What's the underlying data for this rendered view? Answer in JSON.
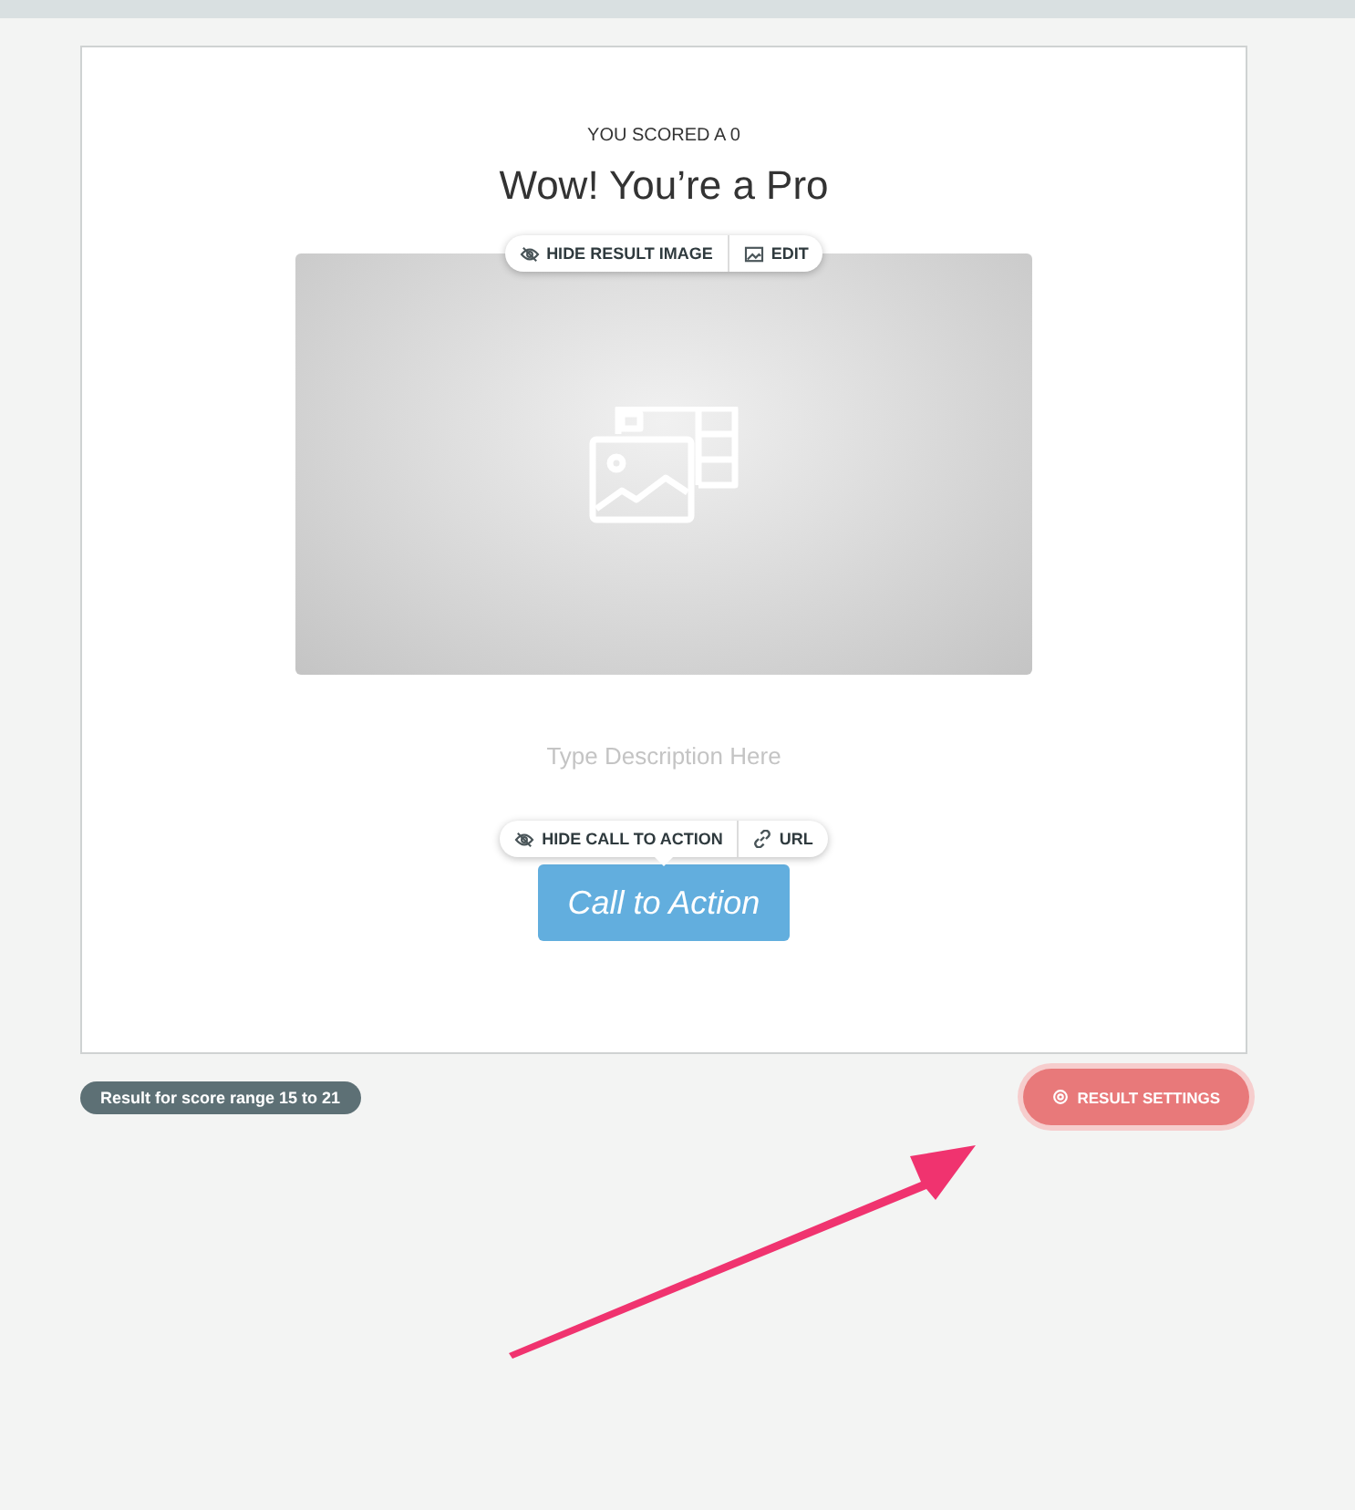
{
  "result_card": {
    "score_label": "YOU SCORED A 0",
    "title": "Wow! You’re a Pro",
    "image_toolbar": [
      {
        "kind": "hide",
        "label": "HIDE RESULT IMAGE"
      },
      {
        "kind": "edit",
        "label": "EDIT"
      }
    ],
    "description": {
      "placeholder": "Type Description Here"
    },
    "cta_toolbar": [
      {
        "kind": "hide",
        "label": "HIDE CALL TO ACTION"
      },
      {
        "kind": "link",
        "label": "URL"
      }
    ],
    "cta_button": "Call to Action"
  },
  "score_range": "Result for score range 15 to 21",
  "settings_button": "RESULT SETTINGS"
}
